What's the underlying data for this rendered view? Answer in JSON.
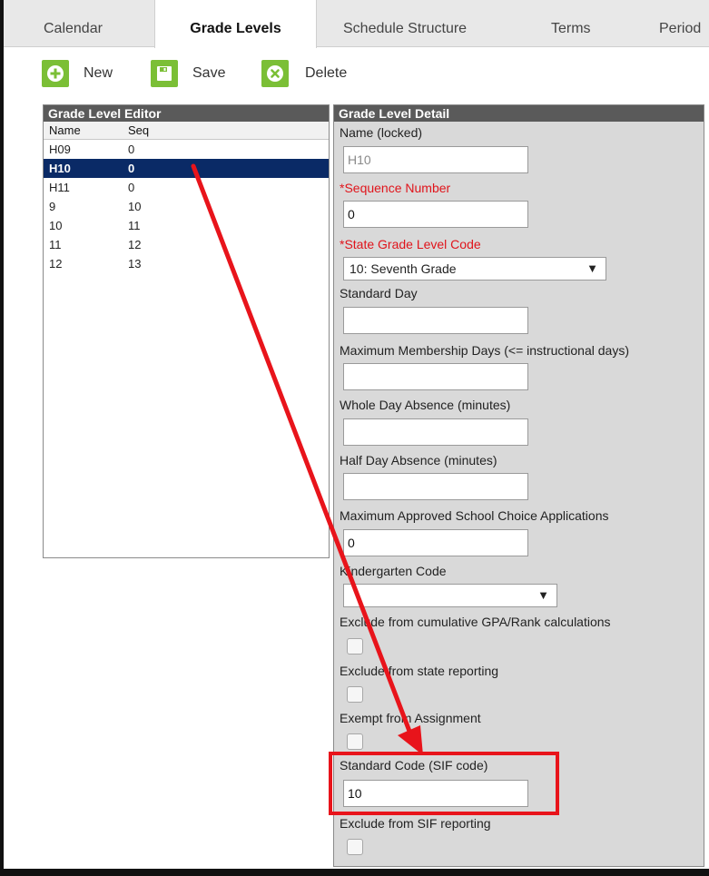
{
  "tabs": [
    {
      "label": "Calendar",
      "active": false
    },
    {
      "label": "Grade Levels",
      "active": true
    },
    {
      "label": "Schedule Structure",
      "active": false
    },
    {
      "label": "Terms",
      "active": false
    },
    {
      "label": "Period",
      "active": false
    }
  ],
  "toolbar": {
    "new_label": "New",
    "save_label": "Save",
    "delete_label": "Delete"
  },
  "editor": {
    "title": "Grade Level Editor",
    "columns": [
      "Name",
      "Seq"
    ],
    "rows": [
      {
        "name": "H09",
        "seq": "0",
        "selected": false
      },
      {
        "name": "H10",
        "seq": "0",
        "selected": true
      },
      {
        "name": "H11",
        "seq": "0",
        "selected": false
      },
      {
        "name": "9",
        "seq": "10",
        "selected": false
      },
      {
        "name": "10",
        "seq": "11",
        "selected": false
      },
      {
        "name": "11",
        "seq": "12",
        "selected": false
      },
      {
        "name": "12",
        "seq": "13",
        "selected": false
      }
    ]
  },
  "detail": {
    "title": "Grade Level Detail",
    "name_label": "Name (locked)",
    "name_value": "H10",
    "sequence_label": "*Sequence Number",
    "sequence_value": "0",
    "state_code_label": "*State Grade Level Code",
    "state_code_value": "10: Seventh Grade",
    "standard_day_label": "Standard Day",
    "standard_day_value": "",
    "max_membership_label": "Maximum Membership Days (<= instructional days)",
    "max_membership_value": "",
    "whole_day_label": "Whole Day Absence (minutes)",
    "whole_day_value": "",
    "half_day_label": "Half Day Absence (minutes)",
    "half_day_value": "",
    "max_choice_label": "Maximum Approved School Choice Applications",
    "max_choice_value": "0",
    "kindergarten_label": "Kindergarten Code",
    "kindergarten_value": "",
    "exclude_gpa_label": "Exclude from cumulative GPA/Rank calculations",
    "exclude_state_label": "Exclude from state reporting",
    "exempt_label": "Exempt from Assignment",
    "sif_code_label": "Standard Code (SIF code)",
    "sif_code_value": "10",
    "exclude_sif_label": "Exclude from SIF reporting"
  },
  "colors": {
    "selected_row": "#0a2a66",
    "toolbar_icon": "#7bbf36",
    "required_label": "#e0141b",
    "annotation": "#e8141b"
  },
  "icons": {
    "new": "plus-circle-icon",
    "save": "floppy-disk-icon",
    "delete": "x-circle-icon"
  }
}
